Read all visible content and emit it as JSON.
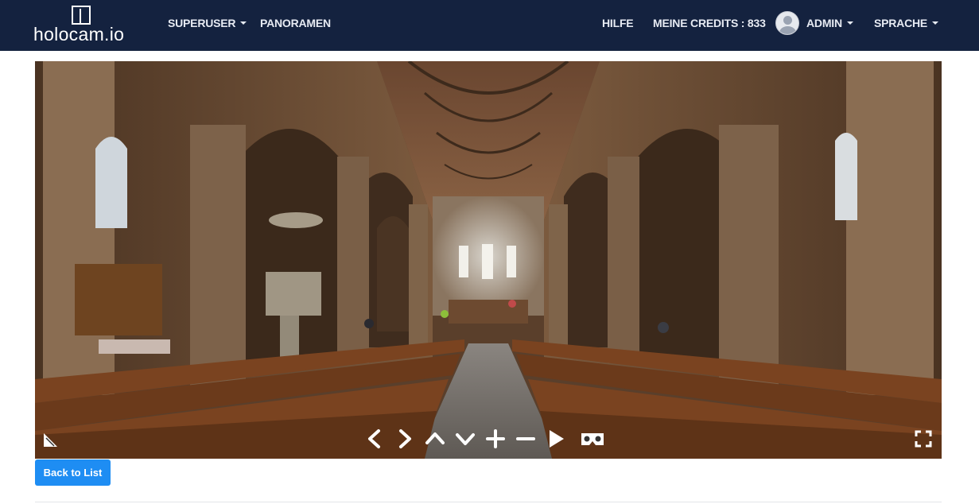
{
  "brand": {
    "name": "holocam.io"
  },
  "nav": {
    "left": [
      {
        "label": "SUPERUSER",
        "dropdown": true
      },
      {
        "label": "PANORAMEN",
        "dropdown": false
      }
    ],
    "right": {
      "help": "HILFE",
      "credits": "MEINE CREDITS : 833",
      "user": "ADMIN",
      "language": "SPRACHE"
    }
  },
  "viewer": {
    "controls": [
      "gyro-toggle-icon",
      "pan-left-icon",
      "pan-right-icon",
      "pan-up-icon",
      "pan-down-icon",
      "zoom-in-icon",
      "zoom-out-icon",
      "autoplay-icon",
      "vr-mode-icon",
      "fullscreen-icon"
    ]
  },
  "actions": {
    "back_label": "Back to List"
  },
  "colors": {
    "navbar": "#14223f",
    "button": "#1e8df3"
  }
}
